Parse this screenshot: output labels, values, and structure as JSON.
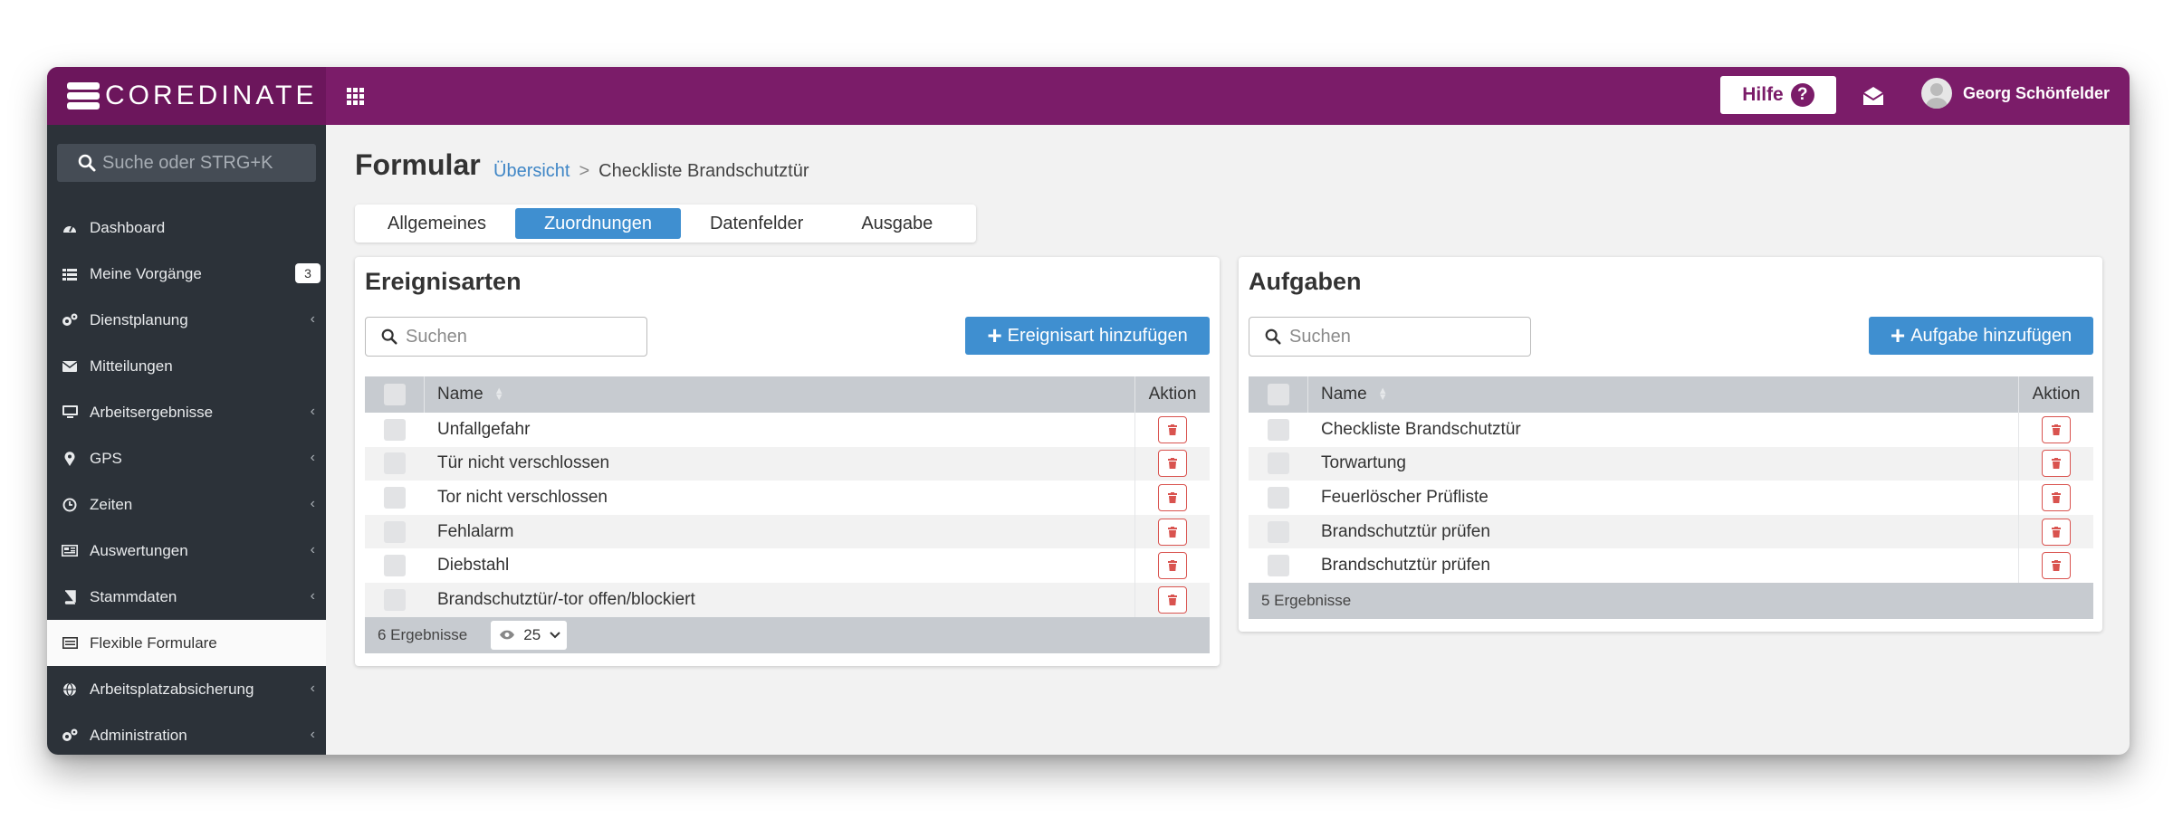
{
  "app": {
    "logo_text": "COREDINATE",
    "help_label": "Hilfe",
    "user_name": "Georg Schönfelder",
    "brand_color": "#7b1c69"
  },
  "sidebar": {
    "search_placeholder": "Suche oder STRG+K",
    "items": [
      {
        "label": "Dashboard",
        "icon": "dashboard-icon",
        "chevron": false
      },
      {
        "label": "Meine Vorgänge",
        "icon": "list-icon",
        "badge": "3"
      },
      {
        "label": "Dienstplanung",
        "icon": "cogs-icon",
        "chevron": true
      },
      {
        "label": "Mitteilungen",
        "icon": "envelope-icon",
        "chevron": false
      },
      {
        "label": "Arbeitsergebnisse",
        "icon": "monitor-icon",
        "chevron": true
      },
      {
        "label": "GPS",
        "icon": "map-pin-icon",
        "chevron": true
      },
      {
        "label": "Zeiten",
        "icon": "clock-icon",
        "chevron": true
      },
      {
        "label": "Auswertungen",
        "icon": "chart-card-icon",
        "chevron": true
      },
      {
        "label": "Stammdaten",
        "icon": "book-icon",
        "chevron": true
      },
      {
        "label": "Flexible Formulare",
        "icon": "form-icon",
        "active": true
      },
      {
        "label": "Arbeitsplatzabsicherung",
        "icon": "globe-icon",
        "chevron": true
      },
      {
        "label": "Administration",
        "icon": "cogs-icon",
        "chevron": true
      }
    ]
  },
  "page": {
    "title": "Formular",
    "breadcrumb_link": "Übersicht",
    "breadcrumb_sep": ">",
    "breadcrumb_current": "Checkliste Brandschutztür",
    "tabs": [
      "Allgemeines",
      "Zuordnungen",
      "Datenfelder",
      "Ausgabe"
    ],
    "active_tab": "Zuordnungen"
  },
  "ereignisarten": {
    "title": "Ereignisarten",
    "search_placeholder": "Suchen",
    "add_label": "Ereignisart hinzufügen",
    "col_name": "Name",
    "col_action": "Aktion",
    "rows": [
      "Unfallgefahr",
      "Tür nicht verschlossen",
      "Tor nicht verschlossen",
      "Fehlalarm",
      "Diebstahl",
      "Brandschutztür/-tor offen/blockiert"
    ],
    "results": "6 Ergebnisse",
    "page_size": "25"
  },
  "aufgaben": {
    "title": "Aufgaben",
    "search_placeholder": "Suchen",
    "add_label": "Aufgabe hinzufügen",
    "col_name": "Name",
    "col_action": "Aktion",
    "rows": [
      "Checkliste Brandschutztür",
      "Torwartung",
      "Feuerlöscher Prüfliste",
      "Brandschutztür prüfen",
      "Brandschutztür prüfen"
    ],
    "results": "5 Ergebnisse"
  }
}
